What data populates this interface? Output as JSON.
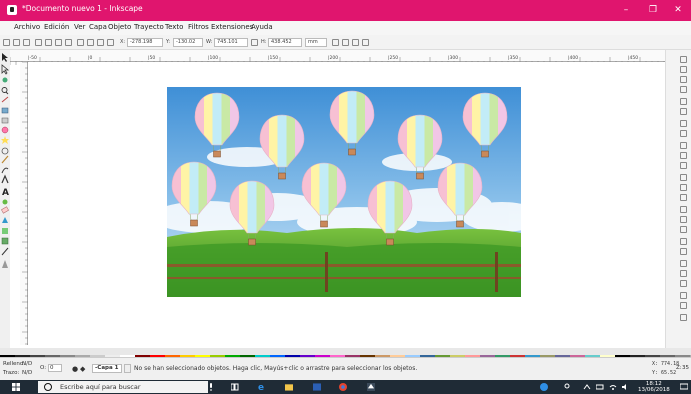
{
  "window": {
    "title": "*Documento nuevo 1 - Inkscape",
    "minimize": "–",
    "maximize": "❐",
    "close": "✕"
  },
  "menu": [
    "Archivo",
    "Edición",
    "Ver",
    "Capa",
    "Objeto",
    "Trayecto",
    "Texto",
    "Filtros",
    "Extensiones",
    "Ayuda"
  ],
  "toolbar": {
    "x_label": "X:",
    "x_value": "-278.198",
    "y_label": "Y:",
    "y_value": "-130.02",
    "w_label": "W:",
    "w_value": "745.101",
    "h_label": "H:",
    "h_value": "438.452",
    "unit": "mm"
  },
  "ruler": {
    "labels": [
      "|-50",
      "|0",
      "|50",
      "|100",
      "|150",
      "|200",
      "|250",
      "|300",
      "|350",
      "|400",
      "|450"
    ]
  },
  "status": {
    "fill_label": "Relleno:",
    "fill_value": "N/D",
    "stroke_label": "Trazo:",
    "stroke_value": "N/D",
    "opacity_label": "O:",
    "opacity_value": "0",
    "layer": "-Capa 1",
    "message": "No se han seleccionado objetos. Haga clic, Mayús+clic o arrastre para seleccionar los objetos.",
    "coord_x": "X: 774.18",
    "coord_y": "Y: 65.52",
    "zoom_label": "Z:",
    "zoom_value": "35"
  },
  "taskbar": {
    "search_placeholder": "Escribe aquí para buscar",
    "time": "18:12",
    "date": "13/06/2018"
  },
  "colors": {
    "titlebar": "#e0156e",
    "taskbar": "#1f2b36",
    "sky": "#5aa0d8",
    "grass": "#49a62a"
  },
  "balloon_colors": [
    "#f7c0d3",
    "#fff4a6",
    "#c2ecf7",
    "#c9e9a5",
    "#f1c6e6"
  ]
}
